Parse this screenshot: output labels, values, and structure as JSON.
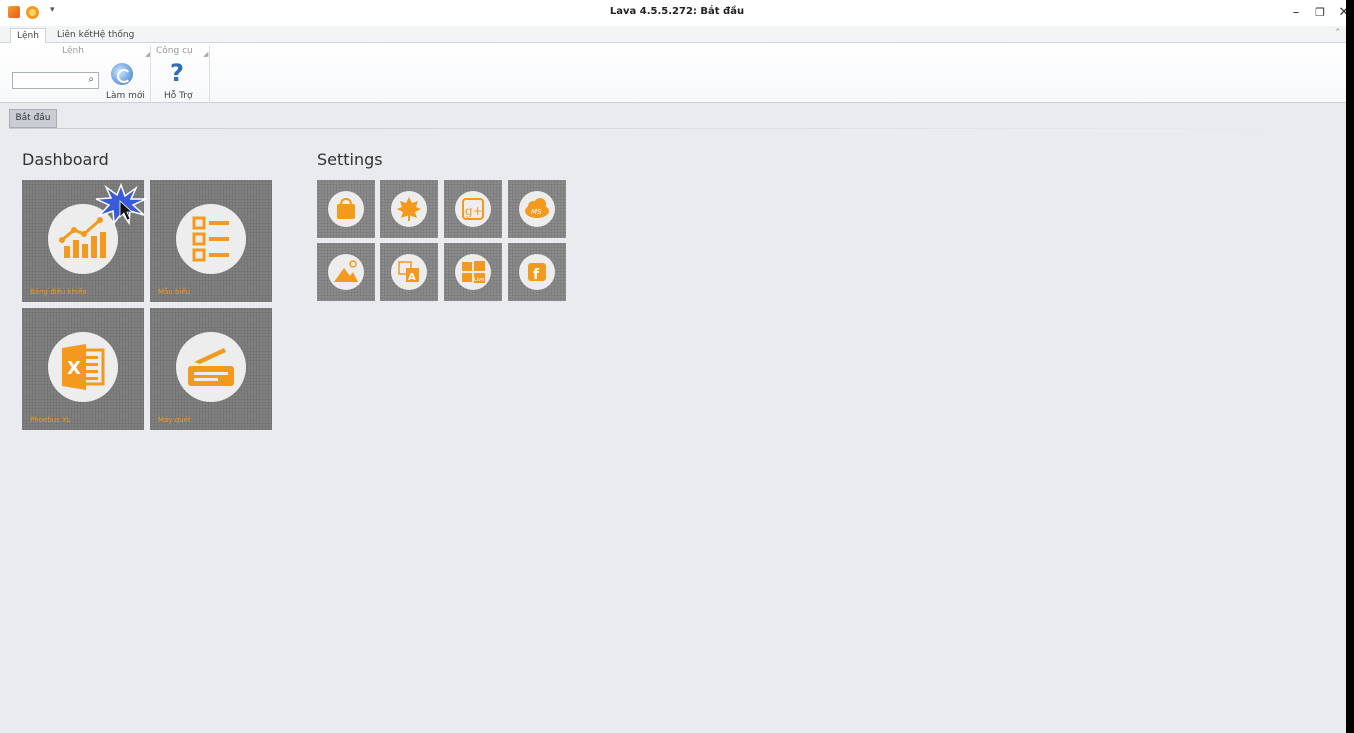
{
  "window": {
    "title": "Lava 4.5.5.272: Bắt đầu",
    "minimize": "–",
    "maximize": "❐",
    "close": "✕",
    "quick_access_dropdown": "▾"
  },
  "ribbon": {
    "tabs": [
      {
        "label": "Lệnh"
      },
      {
        "label": "Liên kết"
      },
      {
        "label": "Hệ thống"
      }
    ],
    "groups": {
      "lenh": "Lệnh",
      "congcu": "Công cụ"
    },
    "search": {
      "value": "",
      "placeholder": "",
      "icon": "⌕"
    },
    "buttons": {
      "refresh": "Làm mới",
      "help": "Hỗ Trợ",
      "help_glyph": "?"
    },
    "collapse": "⌃"
  },
  "document_tab": {
    "label": "Bắt đầu"
  },
  "dashboard": {
    "title": "Dashboard",
    "tiles": [
      {
        "label": "Bảng điều khiển",
        "icon": "chart-icon"
      },
      {
        "label": "Mẫu biểu",
        "icon": "list-icon"
      },
      {
        "label": "Phoebus XL",
        "icon": "excel-icon"
      },
      {
        "label": "Máy quét",
        "icon": "scanner-icon"
      }
    ]
  },
  "settings": {
    "title": "Settings",
    "tiles": [
      {
        "icon": "shopping-bag-icon"
      },
      {
        "icon": "maple-leaf-icon"
      },
      {
        "icon": "google-plus-icon",
        "text": "g+"
      },
      {
        "icon": "cloud-ms-icon",
        "text": "MS"
      },
      {
        "icon": "image-settings-icon"
      },
      {
        "icon": "translate-icon",
        "text": "A"
      },
      {
        "icon": "windows-live-icon",
        "text": "Live"
      },
      {
        "icon": "facebook-icon",
        "text": "f"
      }
    ]
  },
  "colors": {
    "accent": "#f39a1e",
    "tile_bg": "#7f7f7f",
    "background": "#e9ebef"
  }
}
